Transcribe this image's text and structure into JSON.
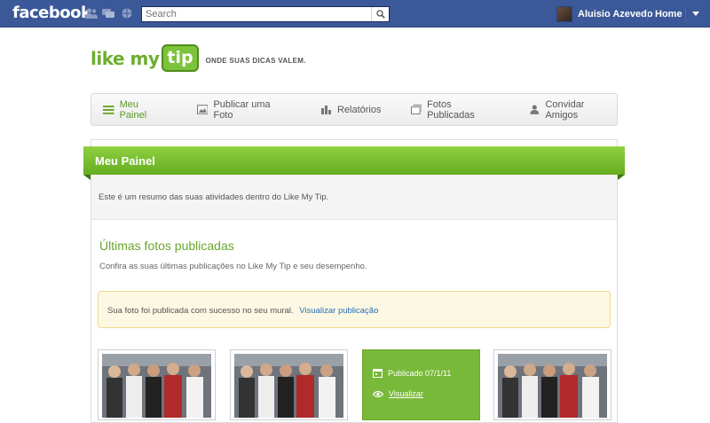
{
  "facebook_bar": {
    "logo": "facebook",
    "search_placeholder": "Search",
    "user_name": "Aluisio Azevedo",
    "home_label": "Home",
    "icons": [
      "friends-icon",
      "messages-icon",
      "notifications-globe-icon",
      "search-icon",
      "account-caret-icon"
    ]
  },
  "app": {
    "logo_word": "like my",
    "logo_tip": "tip",
    "tagline": "ONDE SUAS DICAS VALEM."
  },
  "nav": {
    "items": [
      {
        "label": "Meu Painel",
        "icon": "menu-lines-icon",
        "active": true
      },
      {
        "label": "Publicar uma Foto",
        "icon": "image-icon",
        "active": false
      },
      {
        "label": "Relatórios",
        "icon": "bar-chart-icon",
        "active": false
      },
      {
        "label": "Fotos Publicadas",
        "icon": "photos-stack-icon",
        "active": false
      },
      {
        "label": "Convidar Amigos",
        "icon": "person-icon",
        "active": false
      }
    ]
  },
  "panel": {
    "title": "Meu Painel",
    "intro": "Este é um resumo das suas atividades dentro do Like My Tip.",
    "section_title": "Últimas fotos publicadas",
    "section_subtitle": "Confira as suas últimas publicações no Like My Tip e seu desempenho.",
    "alert_text": "Sua foto foi publicada com sucesso no seu mural.",
    "alert_link": "Visualizar publicação"
  },
  "cards": {
    "published_label": "Publicado 07/1/11",
    "view_label": "Visualizar"
  },
  "colors": {
    "facebook_blue": "#3b5998",
    "brand_green": "#6cae2e",
    "alert_bg": "#fcf8e3",
    "link_blue": "#2a6fb2"
  }
}
